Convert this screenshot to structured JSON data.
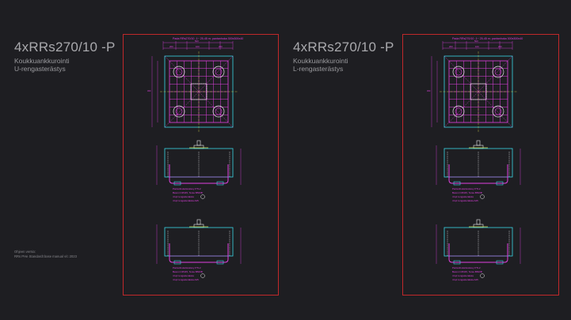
{
  "left": {
    "title": "4xRRs270/10 -P",
    "subtitle_1": "Koukkuankkurointi",
    "subtitle_2": "U-rengasterästys",
    "sheet_header": "Pada RRs270/10 -1~ 25-45 m; pantanhuka 300x300x40"
  },
  "right": {
    "title": "4xRRs270/10 -P",
    "subtitle_1": "Koukkuankkurointi",
    "subtitle_2": "L-rengasterästys",
    "sheet_header": "Pada RRs270/10 -1~ 25-45 m; pantanhuka 300x300x40"
  },
  "meta": {
    "line_1": "Ohjeen versio:",
    "line_2": "RRs PHe Standardt base manual v/c 2023"
  },
  "dims": {
    "d1": "200",
    "d2": "100",
    "d3": "300",
    "d4": "500"
  },
  "notes": {
    "n1": "Pantanhuka/sivalevy PTL2",
    "n2": "Betoni C35/45, Teras B500B",
    "n3": "4 kpl rengasteraksia",
    "n4": "4 kpl rengasteraksia A25"
  },
  "colors": {
    "sheet_border": "#c0282a",
    "magenta": "#e040e0",
    "cyan": "#3ad6e8",
    "white": "#e8e8e8",
    "yellow": "#d8d84a"
  }
}
